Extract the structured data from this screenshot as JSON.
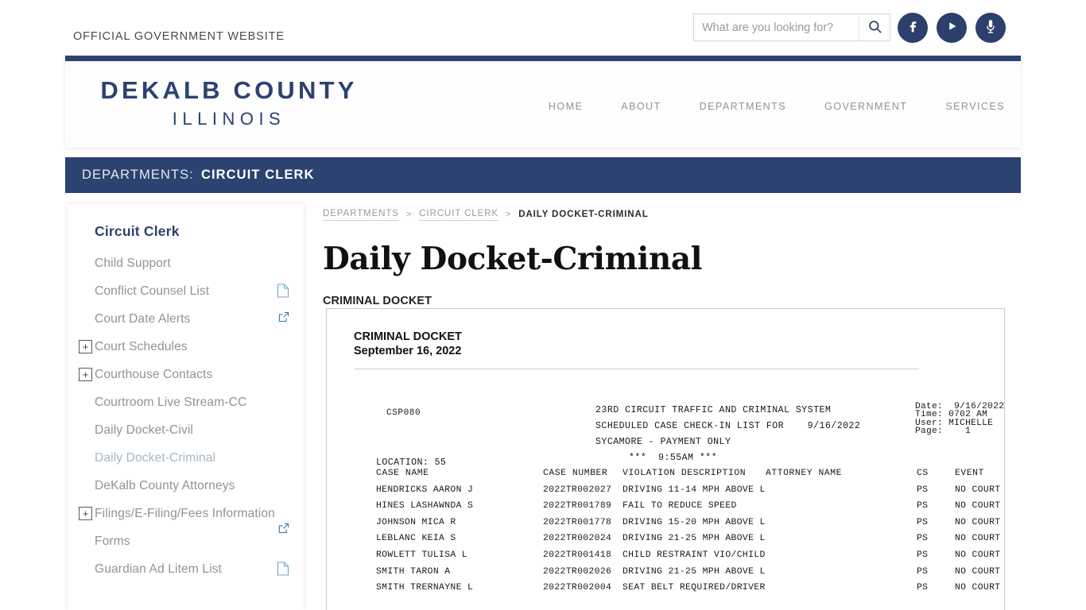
{
  "utility": {
    "official_text": "OFFICIAL GOVERNMENT WEBSITE",
    "search": {
      "placeholder": "What are you looking for?",
      "value": "",
      "button_label": ""
    },
    "social": [
      {
        "name": "facebook-icon",
        "label": "Facebook"
      },
      {
        "name": "youtube-icon",
        "label": "YouTube"
      },
      {
        "name": "podcast-icon",
        "label": "Podcast"
      }
    ]
  },
  "masthead": {
    "logo_line1": "DEKALB COUNTY",
    "logo_line2": "ILLINOIS",
    "nav": [
      {
        "label": "HOME"
      },
      {
        "label": "ABOUT"
      },
      {
        "label": "DEPARTMENTS"
      },
      {
        "label": "GOVERNMENT"
      },
      {
        "label": "SERVICES"
      }
    ]
  },
  "dept_banner": {
    "label": "DEPARTMENTS:",
    "value": "CIRCUIT CLERK"
  },
  "sidebar": {
    "title": "Circuit Clerk",
    "items": [
      {
        "label": "Child Support",
        "plus": false,
        "icon": "",
        "active": false
      },
      {
        "label": "Conflict Counsel List",
        "plus": false,
        "icon": "pdf",
        "active": false
      },
      {
        "label": "Court Date Alerts",
        "plus": false,
        "icon": "extlink",
        "active": false
      },
      {
        "label": "Court Schedules",
        "plus": true,
        "icon": "",
        "active": false
      },
      {
        "label": "Courthouse Contacts",
        "plus": true,
        "icon": "",
        "active": false
      },
      {
        "label": "Courtroom Live Stream-CC",
        "plus": false,
        "icon": "",
        "active": false
      },
      {
        "label": "Daily Docket-Civil",
        "plus": false,
        "icon": "",
        "active": false
      },
      {
        "label": "Daily Docket-Criminal",
        "plus": false,
        "icon": "",
        "active": true
      },
      {
        "label": "DeKalb County Attorneys",
        "plus": false,
        "icon": "",
        "active": false
      },
      {
        "label": "Filings/E-Filing/Fees Information",
        "plus": true,
        "icon": "extlink",
        "active": false
      },
      {
        "label": "Forms",
        "plus": false,
        "icon": "",
        "active": false
      },
      {
        "label": "Guardian Ad Litem List",
        "plus": false,
        "icon": "pdf",
        "active": false
      }
    ]
  },
  "breadcrumb": {
    "items": [
      {
        "label": "DEPARTMENTS",
        "current": false
      },
      {
        "label": "CIRCUIT CLERK",
        "current": false
      },
      {
        "label": "DAILY DOCKET-CRIMINAL",
        "current": true
      }
    ],
    "separator": ">"
  },
  "page": {
    "title": "Daily Docket-Criminal",
    "subheading": "CRIMINAL DOCKET"
  },
  "docket": {
    "heading_line1": "CRIMINAL DOCKET",
    "heading_line2": "September 16, 2022",
    "report_code": "CSP080",
    "location_line": "LOCATION: 55",
    "center_lines": [
      "23RD CIRCUIT TRAFFIC AND CRIMINAL SYSTEM",
      "SCHEDULED CASE CHECK-IN LIST FOR    9/16/2022",
      "SYCAMORE - PAYMENT ONLY"
    ],
    "time_banner": "***  9:55AM ***",
    "meta": [
      "Date:  9/16/2022",
      "Time: 0702 AM",
      "User: MICHELLE",
      "Page:    1"
    ],
    "columns": [
      "CASE NAME",
      "CASE NUMBER",
      "VIOLATION DESCRIPTION",
      "ATTORNEY NAME",
      "CS",
      "EVENT"
    ],
    "rows": [
      {
        "case_name": "HENDRICKS AARON J",
        "case_number": "2022TR002027",
        "violation": "DRIVING 11-14 MPH ABOVE L",
        "attorney": "",
        "cs": "PS",
        "event": "NO COURT - P"
      },
      {
        "case_name": "HINES LASHAWNDA S",
        "case_number": "2022TR001789",
        "violation": "FAIL TO REDUCE SPEED",
        "attorney": "",
        "cs": "PS",
        "event": "NO COURT - P"
      },
      {
        "case_name": "JOHNSON MICA R",
        "case_number": "2022TR001778",
        "violation": "DRIVING 15-20 MPH ABOVE L",
        "attorney": "",
        "cs": "PS",
        "event": "NO COURT - P"
      },
      {
        "case_name": "LEBLANC KEIA S",
        "case_number": "2022TR002024",
        "violation": "DRIVING 21-25 MPH ABOVE L",
        "attorney": "",
        "cs": "PS",
        "event": "NO COURT - P"
      },
      {
        "case_name": "ROWLETT TULISA L",
        "case_number": "2022TR001418",
        "violation": "CHILD RESTRAINT VIO/CHILD",
        "attorney": "",
        "cs": "PS",
        "event": "NO COURT - P"
      },
      {
        "case_name": "SMITH TARON A",
        "case_number": "2022TR002026",
        "violation": "DRIVING 21-25 MPH ABOVE L",
        "attorney": "",
        "cs": "PS",
        "event": "NO COURT - P"
      },
      {
        "case_name": "SMITH TRERNAYNE L",
        "case_number": "2022TR002004",
        "violation": "SEAT BELT REQUIRED/DRIVER",
        "attorney": "",
        "cs": "PS",
        "event": "NO COURT - P"
      }
    ]
  },
  "colors": {
    "navy": "#2c4270",
    "nav_text": "#8b949e",
    "sidebar_text": "#8d949c",
    "active_link": "#a8b5c6"
  }
}
